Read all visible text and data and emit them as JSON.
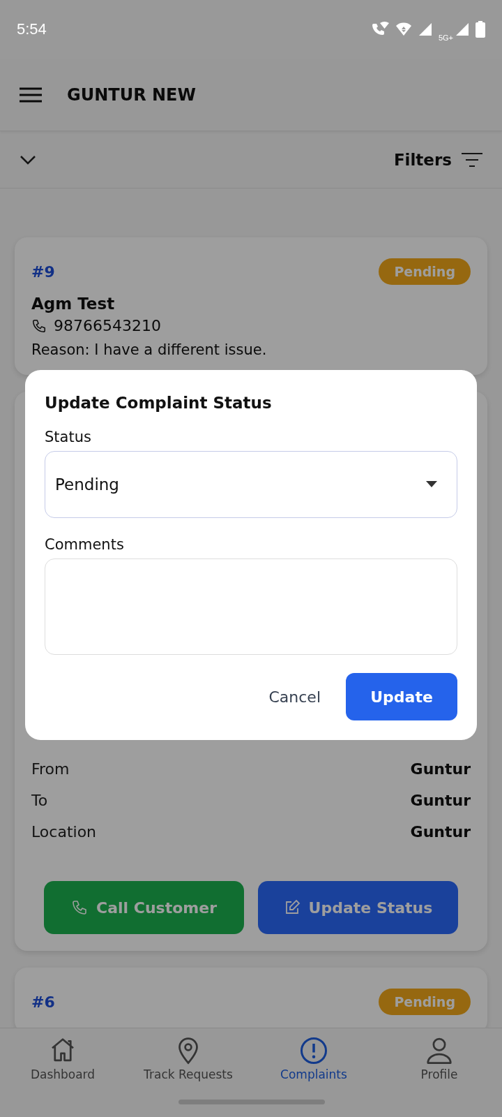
{
  "status_bar": {
    "time": "5:54",
    "network": "5G+"
  },
  "app_bar": {
    "title": "GUNTUR NEW"
  },
  "filter_bar": {
    "label": "Filters"
  },
  "complaints": [
    {
      "number": "#9",
      "status": "Pending",
      "name": "Agm Test",
      "phone": "98766543210",
      "reason": "Reason: I have a different issue."
    },
    {
      "details": [
        {
          "label": "From",
          "value": "Guntur"
        },
        {
          "label": "To",
          "value": "Guntur"
        },
        {
          "label": "Location",
          "value": "Guntur"
        }
      ],
      "actions": [
        {
          "kind": "call",
          "label": "Call Customer"
        },
        {
          "kind": "update",
          "label": "Update Status"
        }
      ]
    },
    {
      "number": "#6",
      "status": "Pending"
    }
  ],
  "dialog": {
    "title": "Update Complaint Status",
    "status_label": "Status",
    "status_value": "Pending",
    "comments_label": "Comments",
    "cancel": "Cancel",
    "confirm": "Update"
  },
  "bottom_nav": [
    {
      "label": "Dashboard",
      "selected": false
    },
    {
      "label": "Track Requests",
      "selected": false
    },
    {
      "label": "Complaints",
      "selected": true
    },
    {
      "label": "Profile",
      "selected": false
    }
  ]
}
